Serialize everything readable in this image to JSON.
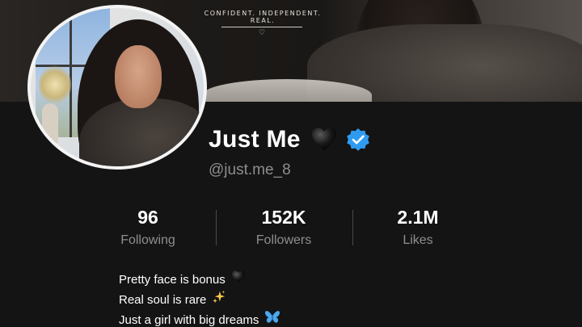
{
  "banner": {
    "tagline": "CONFIDENT. INDEPENDENT. REAL.",
    "tagline_icon": "heart-outline-icon"
  },
  "profile": {
    "display_name": "Just Me",
    "name_icons": [
      "black-heart-icon",
      "verified-badge-icon"
    ],
    "handle": "@just.me_8",
    "verified_color": "#2f9bf0"
  },
  "stats": [
    {
      "value": "96",
      "label": "Following"
    },
    {
      "value": "152K",
      "label": "Followers"
    },
    {
      "value": "2.1M",
      "label": "Likes"
    }
  ],
  "bio": [
    {
      "text": "Pretty face is bonus",
      "icon": "black-heart-icon"
    },
    {
      "text": "Real soul is rare",
      "icon": "sparkles-icon"
    },
    {
      "text": "Just a girl with big dreams",
      "icon": "butterfly-icon"
    }
  ],
  "colors": {
    "background": "#141414",
    "primary_text": "#ffffff",
    "secondary_text": "#8e8e8e"
  }
}
